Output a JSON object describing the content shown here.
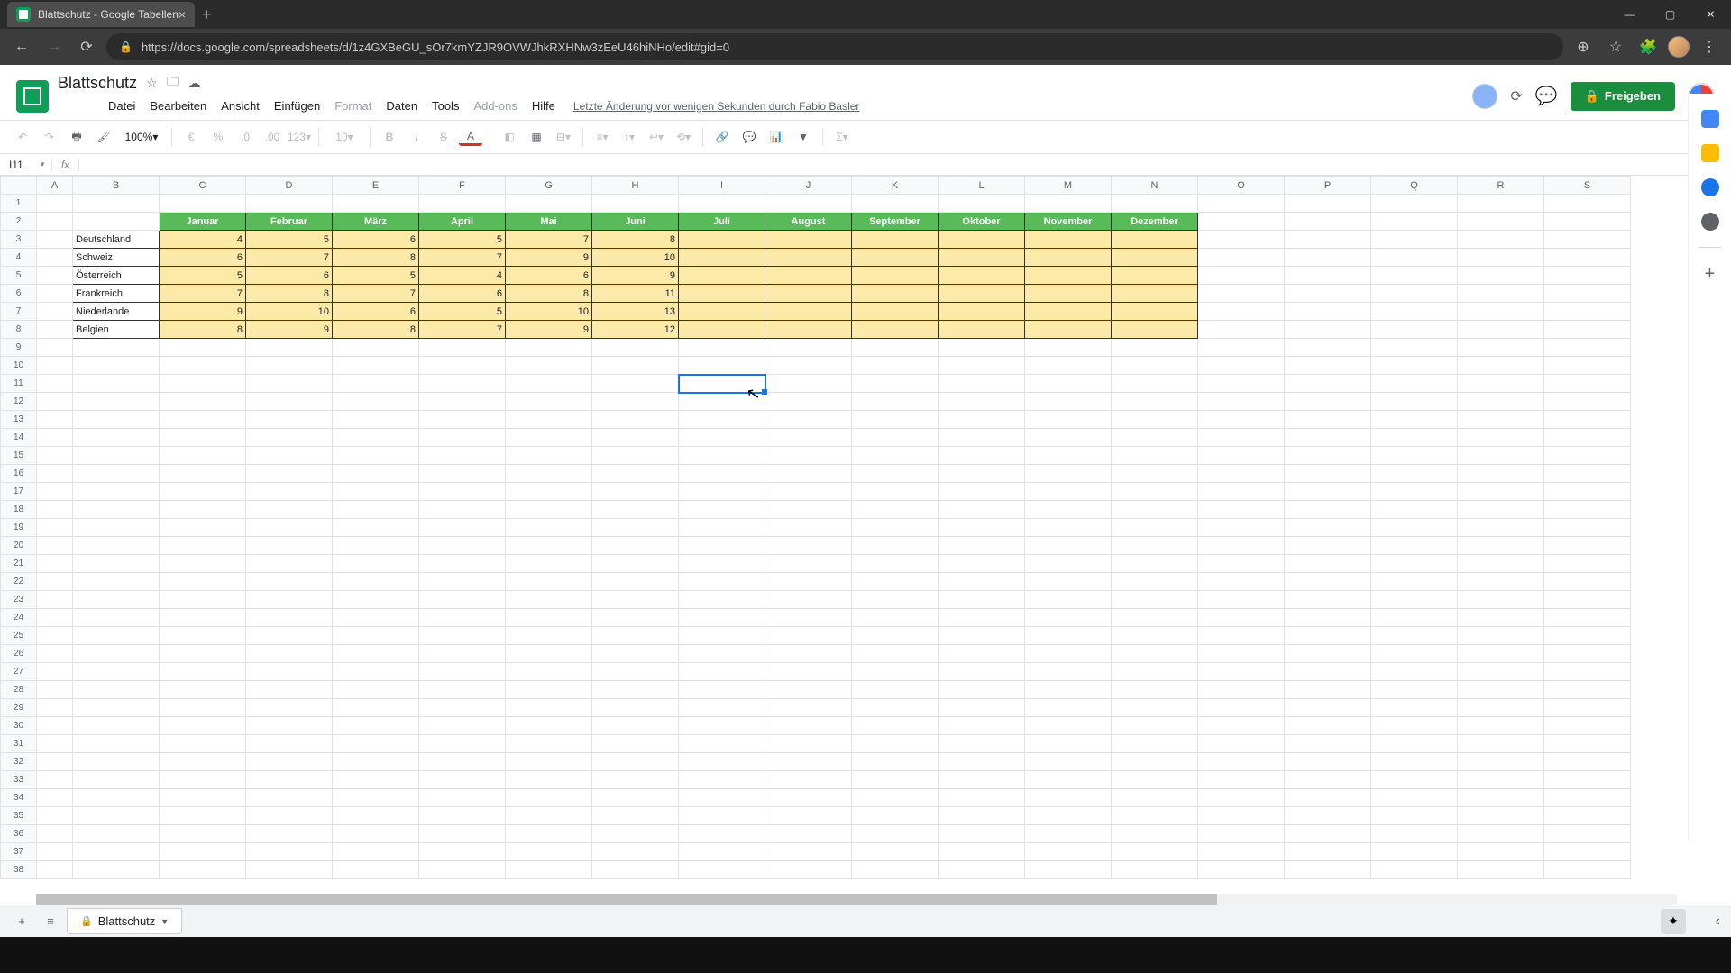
{
  "browser": {
    "tab_title": "Blattschutz - Google Tabellen",
    "url": "https://docs.google.com/spreadsheets/d/1z4GXBeGU_sOr7kmYZJR9OVWJhkRXHNw3zEeU46hiNHo/edit#gid=0"
  },
  "header": {
    "doc_title": "Blattschutz",
    "share_label": "Freigeben",
    "last_edit": "Letzte Änderung vor wenigen Sekunden durch Fabio Basler"
  },
  "menu": {
    "items": [
      "Datei",
      "Bearbeiten",
      "Ansicht",
      "Einfügen",
      "Format",
      "Daten",
      "Tools",
      "Add-ons",
      "Hilfe"
    ],
    "disabled": [
      "Format",
      "Add-ons"
    ]
  },
  "toolbar": {
    "zoom": "100%",
    "font_size": "10"
  },
  "name_box": "I11",
  "columns": [
    "A",
    "B",
    "C",
    "D",
    "E",
    "F",
    "G",
    "H",
    "I",
    "J",
    "K",
    "L",
    "M",
    "N",
    "O",
    "P",
    "Q",
    "R",
    "S"
  ],
  "months": [
    "Januar",
    "Februar",
    "März",
    "April",
    "Mai",
    "Juni",
    "Juli",
    "August",
    "September",
    "Oktober",
    "November",
    "Dezember"
  ],
  "rows": [
    {
      "label": "Deutschland",
      "values": [
        4,
        5,
        6,
        5,
        7,
        8
      ]
    },
    {
      "label": "Schweiz",
      "values": [
        6,
        7,
        8,
        7,
        9,
        10
      ]
    },
    {
      "label": "Österreich",
      "values": [
        5,
        6,
        5,
        4,
        6,
        9
      ]
    },
    {
      "label": "Frankreich",
      "values": [
        7,
        8,
        7,
        6,
        8,
        11
      ]
    },
    {
      "label": "Niederlande",
      "values": [
        9,
        10,
        6,
        5,
        10,
        13
      ]
    },
    {
      "label": "Belgien",
      "values": [
        8,
        9,
        8,
        7,
        9,
        12
      ]
    }
  ],
  "sheet_tab": "Blattschutz",
  "chart_data": {
    "type": "table",
    "title": "Blattschutz",
    "columns": [
      "Januar",
      "Februar",
      "März",
      "April",
      "Mai",
      "Juni",
      "Juli",
      "August",
      "September",
      "Oktober",
      "November",
      "Dezember"
    ],
    "rows": [
      "Deutschland",
      "Schweiz",
      "Österreich",
      "Frankreich",
      "Niederlande",
      "Belgien"
    ],
    "values": [
      [
        4,
        5,
        6,
        5,
        7,
        8,
        null,
        null,
        null,
        null,
        null,
        null
      ],
      [
        6,
        7,
        8,
        7,
        9,
        10,
        null,
        null,
        null,
        null,
        null,
        null
      ],
      [
        5,
        6,
        5,
        4,
        6,
        9,
        null,
        null,
        null,
        null,
        null,
        null
      ],
      [
        7,
        8,
        7,
        6,
        8,
        11,
        null,
        null,
        null,
        null,
        null,
        null
      ],
      [
        9,
        10,
        6,
        5,
        10,
        13,
        null,
        null,
        null,
        null,
        null,
        null
      ],
      [
        8,
        9,
        8,
        7,
        9,
        12,
        null,
        null,
        null,
        null,
        null,
        null
      ]
    ]
  }
}
